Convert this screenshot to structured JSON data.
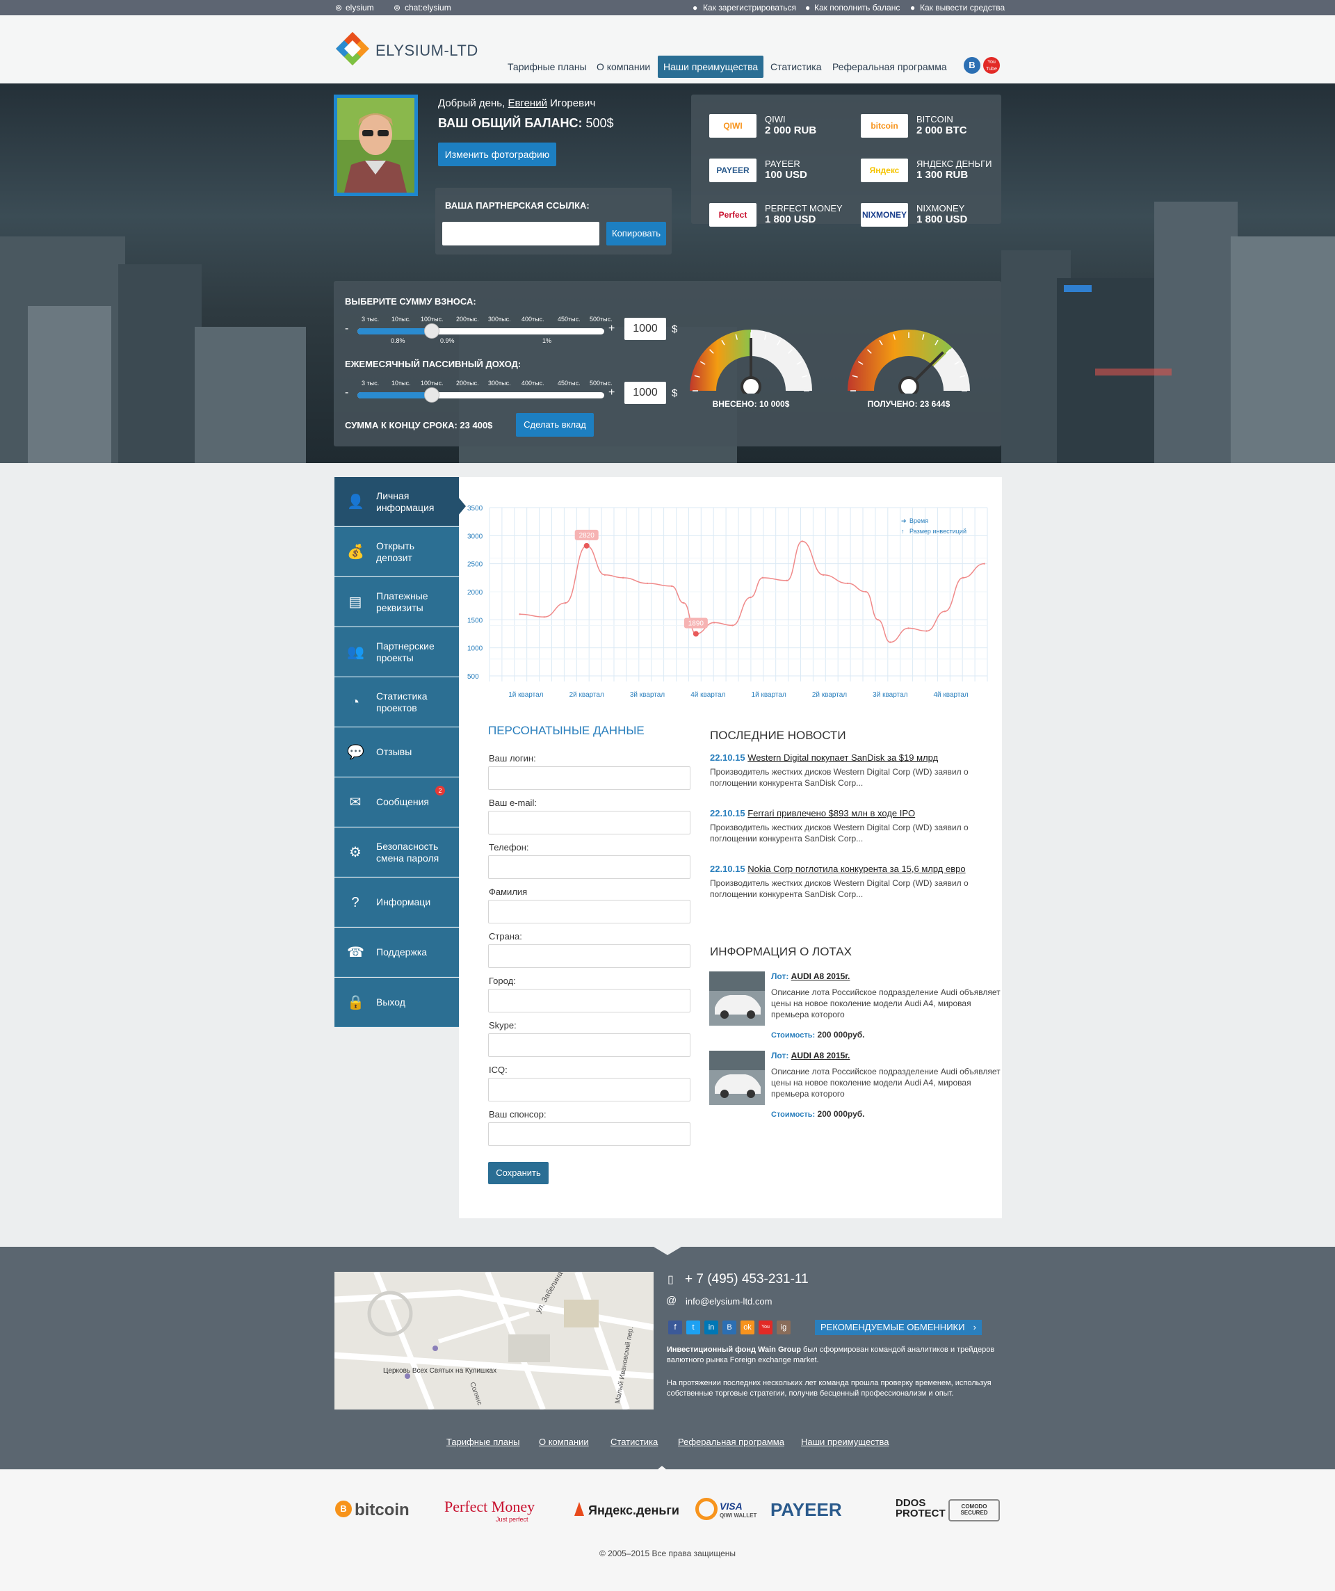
{
  "topbar": {
    "skype1": "elysium",
    "skype2": "chat:elysium",
    "links": [
      "Как зарегистрироваться",
      "Как пополнить баланс",
      "Как вывести средства"
    ]
  },
  "logo": {
    "text": "ELYSIUM-LTD"
  },
  "nav": [
    "Тарифные планы",
    "О компании",
    "Наши преимущества",
    "Статистика",
    "Реферальная программа"
  ],
  "social_header": [
    "B",
    "You Tube"
  ],
  "profile": {
    "greeting": "Добрый день,",
    "first_name": "Евгений",
    "patronymic": "Игоревич",
    "balance_label": "ВАШ ОБЩИЙ БАЛАНС:",
    "balance_value": "500$",
    "change_photo": "Изменить фотографию",
    "partner_link_label": "ВАША ПАРТНЕРСКАЯ ССЫЛКА:",
    "copy_button": "Копировать"
  },
  "wallets": [
    {
      "logo": "QIWI",
      "name": "QIWI",
      "amount": "2 000 RUB",
      "color": "#f7941d"
    },
    {
      "logo": "bitcoin",
      "name": "BITCOIN",
      "amount": "2 000 BTC",
      "color": "#f7931a"
    },
    {
      "logo": "PAYEER",
      "name": "PAYEER",
      "amount": "100 USD",
      "color": "#2a5a8c"
    },
    {
      "logo": "Яндекс",
      "name": "ЯНДЕКС ДЕНЬГИ",
      "amount": "1 300 RUB",
      "color": "#f5c400"
    },
    {
      "logo": "Perfect Money",
      "name": "PERFECT MONEY",
      "amount": "1 800 USD",
      "color": "#c8102e"
    },
    {
      "logo": "NIXMONEY",
      "name": "NIXMONEY",
      "amount": "1 800 USD",
      "color": "#1a3f8c"
    }
  ],
  "calculator": {
    "deposit_label": "ВЫБЕРИТЕ СУММУ ВЗНОСА:",
    "income_label": "ЕЖЕМЕСЯЧНЫЙ ПАССИВНЫЙ ДОХОД:",
    "ticks": [
      "3 тыс.",
      "10тыс.",
      "100тыс.",
      "200тыс.",
      "300тыс.",
      "400тыс.",
      "450тыс.",
      "500тыс."
    ],
    "rates": [
      "0.8%",
      "0.9%",
      "1%"
    ],
    "minus": "-",
    "plus": "+",
    "deposit_value": "1000",
    "income_value": "1000",
    "currency": "$",
    "slider1_level": 0.3,
    "slider2_level": 0.3,
    "total_label": "СУММА К КОНЦУ СРОКА:",
    "total_value": "23 400$",
    "make_deposit": "Сделать вклад"
  },
  "gauges": [
    {
      "label": "ВНЕСЕНО:",
      "value": "10 000$",
      "level": 0.5
    },
    {
      "label": "ПОЛУЧЕНО:",
      "value": "23 644$",
      "level": 0.75
    }
  ],
  "sidebar": [
    {
      "label": "Личная информация",
      "icon": "user-icon"
    },
    {
      "label": "Открыть депозит",
      "icon": "money-bag-icon"
    },
    {
      "label": "Платежные реквизиты",
      "icon": "card-icon"
    },
    {
      "label": "Партнерские проекты",
      "icon": "group-icon"
    },
    {
      "label": "Статистика проектов",
      "icon": "pie-chart-icon"
    },
    {
      "label": "Отзывы",
      "icon": "chat-icon"
    },
    {
      "label": "Сообщения",
      "icon": "envelope-icon",
      "badge": "2"
    },
    {
      "label": "Безопасность смена пароля",
      "icon": "gear-icon"
    },
    {
      "label": "Информаци",
      "icon": "question-icon"
    },
    {
      "label": "Поддержка",
      "icon": "phone-icon"
    },
    {
      "label": "Выход",
      "icon": "lock-icon"
    }
  ],
  "chart_data": {
    "type": "line",
    "y_ticks": [
      "3500",
      "3000",
      "2500",
      "2000",
      "1500",
      "1000",
      "500"
    ],
    "ylim": [
      500,
      3500
    ],
    "categories": [
      "1й квартал",
      "2й квартал",
      "3й квартал",
      "4й квартал",
      "1й квартал",
      "2й квартал",
      "3й квартал",
      "4й квартал"
    ],
    "legend": [
      "Время",
      "Размер инвестиций"
    ],
    "annotations": [
      {
        "label": "2820",
        "x": 1.6,
        "y": 2820
      },
      {
        "label": "1890",
        "x": 3.4,
        "y": 1250
      }
    ],
    "series": [
      {
        "values": [
          {
            "x": 0.5,
            "y": 1600
          },
          {
            "x": 0.9,
            "y": 1550
          },
          {
            "x": 1.25,
            "y": 1800
          },
          {
            "x": 1.6,
            "y": 2820
          },
          {
            "x": 1.9,
            "y": 2300
          },
          {
            "x": 2.2,
            "y": 2250
          },
          {
            "x": 2.6,
            "y": 2150
          },
          {
            "x": 3.0,
            "y": 2100
          },
          {
            "x": 3.2,
            "y": 1800
          },
          {
            "x": 3.4,
            "y": 1250
          },
          {
            "x": 3.7,
            "y": 1450
          },
          {
            "x": 4.0,
            "y": 1400
          },
          {
            "x": 4.3,
            "y": 1900
          },
          {
            "x": 4.5,
            "y": 2250
          },
          {
            "x": 4.9,
            "y": 2200
          },
          {
            "x": 5.15,
            "y": 2900
          },
          {
            "x": 5.5,
            "y": 2300
          },
          {
            "x": 5.9,
            "y": 2150
          },
          {
            "x": 6.2,
            "y": 2000
          },
          {
            "x": 6.4,
            "y": 1500
          },
          {
            "x": 6.6,
            "y": 1100
          },
          {
            "x": 6.9,
            "y": 1350
          },
          {
            "x": 7.2,
            "y": 1300
          },
          {
            "x": 7.5,
            "y": 1650
          },
          {
            "x": 7.8,
            "y": 2250
          },
          {
            "x": 8.15,
            "y": 2500
          }
        ]
      }
    ]
  },
  "personal": {
    "title": "ПЕРСОНАТЫНЫЕ ДАННЫЕ",
    "fields": [
      "Ваш логин:",
      "Ваш e-mail:",
      "Телефон:",
      "Фамилия",
      "Страна:",
      "Город:",
      "Skype:",
      "ICQ:",
      "Ваш спонсор:"
    ],
    "save": "Сохранить"
  },
  "news": {
    "title": "ПОСЛЕДНИЕ НОВОСТИ",
    "items": [
      {
        "date": "22.10.15",
        "headline": "Western Digital покупает SanDisk за $19 млрд",
        "text": "Производитель жестких дисков Western Digital Corp (WD) заявил о поглощении конкурента SanDisk Corp..."
      },
      {
        "date": "22.10.15",
        "headline": "Ferrari привлечено $893 млн в ходе IPO",
        "text": "Производитель жестких дисков Western Digital Corp (WD) заявил о поглощении конкурента SanDisk Corp..."
      },
      {
        "date": "22.10.15",
        "headline": "Nokia Corp поглотила конкурента за 15,6 млрд евро",
        "text": "Производитель жестких дисков Western Digital Corp (WD) заявил о поглощении конкурента SanDisk Corp..."
      }
    ]
  },
  "lots": {
    "title": "ИНФОРМАЦИЯ О ЛОТАХ",
    "items": [
      {
        "lot_label": "Лот:",
        "name": "AUDI A8 2015г.",
        "desc": "Описание лота Российское подразделение Audi объявляет цены на новое поколение модели Audi A4, мировая премьера которого",
        "price_label": "Стоимость:",
        "price": "200 000руб."
      },
      {
        "lot_label": "Лот:",
        "name": "AUDI A8 2015г.",
        "desc": "Описание лота Российское подразделение Audi объявляет цены на новое поколение модели Audi A4, мировая премьера которого",
        "price_label": "Стоимость:",
        "price": "200 000руб."
      }
    ]
  },
  "footer": {
    "phone": "+ 7 (495) 453-231-11",
    "email": "info@elysium-ltd.com",
    "social": [
      "f",
      "t",
      "in",
      "B",
      "ok",
      "You",
      "ig"
    ],
    "exchangers": "РЕКОМЕНДУЕМЫЕ ОБМЕННИКИ",
    "about1_bold": "Инвестиционный фонд Wain Group",
    "about1": " был сформирован командой аналитиков и трейдеров валютного рынка Foreign exchange market.",
    "about2": "На протяжении последних нескольких лет команда прошла проверку временем, используя собственные торговые стратегии, получив бесценный профессионализм и опыт.",
    "map_labels": [
      "ул. Забелина",
      "Малый Ивановский пер.",
      "Церковь Всех Святых на Кулишках",
      "Солянс"
    ],
    "links": [
      "Тарифные планы",
      "О компании",
      "Статистика",
      "Реферальная программа",
      "Наши преимущества"
    ]
  },
  "partners": [
    "bitcoin",
    "Perfect Money",
    "Just perfect",
    "Яндекс.деньги",
    "VISA",
    "QIWI WALLET",
    "PAYEER",
    "DDOS PROTECT",
    "COMODO SECURED"
  ],
  "copyright": "© 2005–2015 Все права защищены"
}
